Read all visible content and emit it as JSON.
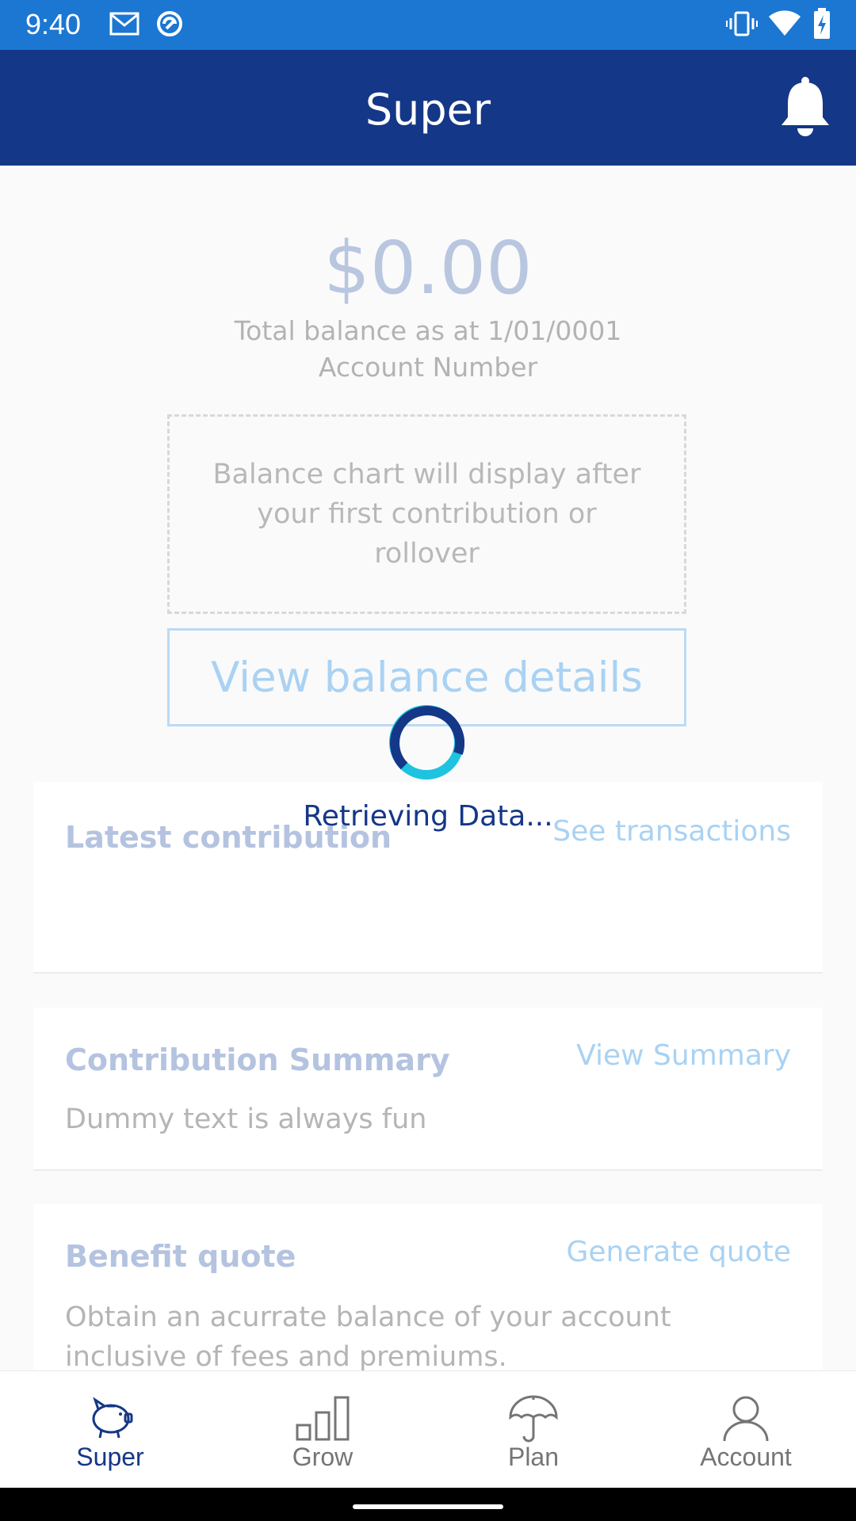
{
  "status_bar": {
    "time": "9:40",
    "icons": [
      "gmail-icon",
      "sync-icon",
      "vibrate-icon",
      "wifi-icon",
      "battery-charging-icon"
    ]
  },
  "app_bar": {
    "title": "Super",
    "action_icon": "bell-icon"
  },
  "balance": {
    "amount": "$0.00",
    "as_at": "Total balance as at 1/01/0001",
    "account_label": "Account Number"
  },
  "chart_placeholder": {
    "text": "Balance chart will display after your first contribution or rollover"
  },
  "view_balance_button": "View balance details",
  "loading": {
    "text": "Retrieving Data..."
  },
  "cards": [
    {
      "title": "Latest contribution",
      "link": "See transactions",
      "body": ""
    },
    {
      "title": "Contribution Summary",
      "link": "View Summary",
      "body": "Dummy text is always fun"
    },
    {
      "title": "Benefit quote",
      "link": "Generate quote",
      "body": "Obtain an acurrate balance of your account inclusive of fees and premiums."
    }
  ],
  "bottom_nav": [
    {
      "label": "Super",
      "icon": "piggy-bank-icon",
      "active": true
    },
    {
      "label": "Grow",
      "icon": "bar-chart-icon",
      "active": false
    },
    {
      "label": "Plan",
      "icon": "umbrella-icon",
      "active": false
    },
    {
      "label": "Account",
      "icon": "person-icon",
      "active": false
    }
  ],
  "colors": {
    "status_bar": "#1b77d2",
    "app_bar": "#143787",
    "accent_link": "#a9d2f3",
    "spinner_dark": "#143787",
    "spinner_light": "#1ec3e0"
  }
}
